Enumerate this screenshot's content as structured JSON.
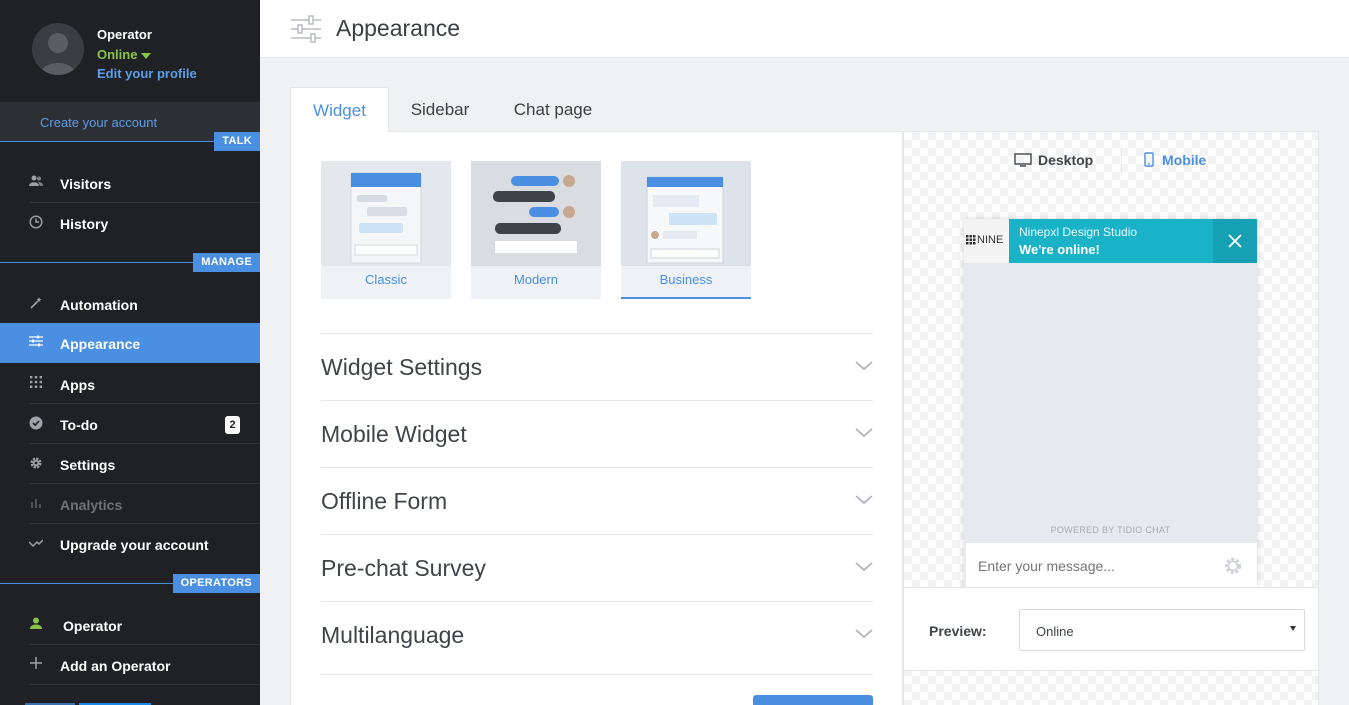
{
  "profile": {
    "name": "Operator",
    "status": "Online",
    "edit_link": "Edit your profile"
  },
  "create_account": "Create your account",
  "sections": {
    "talk": "TALK",
    "manage": "MANAGE",
    "operators": "OPERATORS"
  },
  "nav": {
    "visitors": "Visitors",
    "history": "History",
    "automation": "Automation",
    "appearance": "Appearance",
    "apps": "Apps",
    "todo": "To-do",
    "todo_count": "2",
    "settings": "Settings",
    "analytics": "Analytics",
    "upgrade": "Upgrade your account",
    "operator": "Operator",
    "add_operator": "Add an Operator"
  },
  "header": {
    "title": "Appearance"
  },
  "tabs": [
    "Widget",
    "Sidebar",
    "Chat page"
  ],
  "styles": [
    "Classic",
    "Modern",
    "Business"
  ],
  "sections_list": [
    "Widget Settings",
    "Mobile Widget",
    "Offline Form",
    "Pre-chat Survey",
    "Multilanguage"
  ],
  "preview": {
    "desktop": "Desktop",
    "mobile": "Mobile",
    "logo_text": "NINE",
    "studio": "Ninepxl Design Studio",
    "online": "We're online!",
    "powered": "POWERED BY TIDIO CHAT",
    "input_placeholder": "Enter your message...",
    "label": "Preview:",
    "selected": "Online"
  },
  "colors": {
    "accent": "#4a8fe2",
    "sidebar": "#1f2124",
    "widget_header": "#1ab2c7"
  }
}
